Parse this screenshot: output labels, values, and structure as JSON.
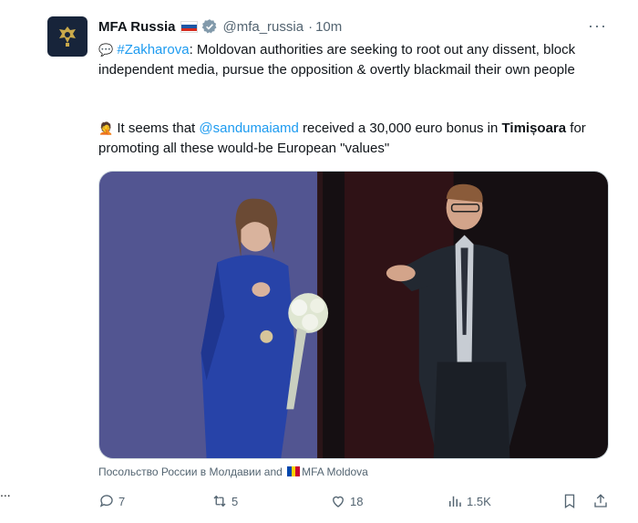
{
  "tweet": {
    "author_name": "MFA Russia",
    "author_flag": "russia-flag",
    "author_handle": "@mfa_russia",
    "separator": "·",
    "time": "10m",
    "more_icon": "more-icon",
    "line1_hashtag": "#Zakharova",
    "line1_text": ": Moldovan authorities are seeking to root out any dissent, block independent media, pursue the opposition & overtly blackmail their own people",
    "line2_prefix": "It seems that ",
    "line2_mention": "@sandumaiamd",
    "line2_mid": " received a 30,000 euro bonus in ",
    "line2_bold": "Timișoara",
    "line2_end": " for promoting all these would-be European \"values\"",
    "caption_a": "Посольство России в Молдавии and",
    "caption_b": "MFA Moldova",
    "colors": {
      "link": "#1d9bf0",
      "muted": "#536471",
      "text": "#0f1419"
    }
  },
  "actions": {
    "replies": "7",
    "reposts": "5",
    "likes": "18",
    "views": "1.5K"
  },
  "left_dots": "..."
}
